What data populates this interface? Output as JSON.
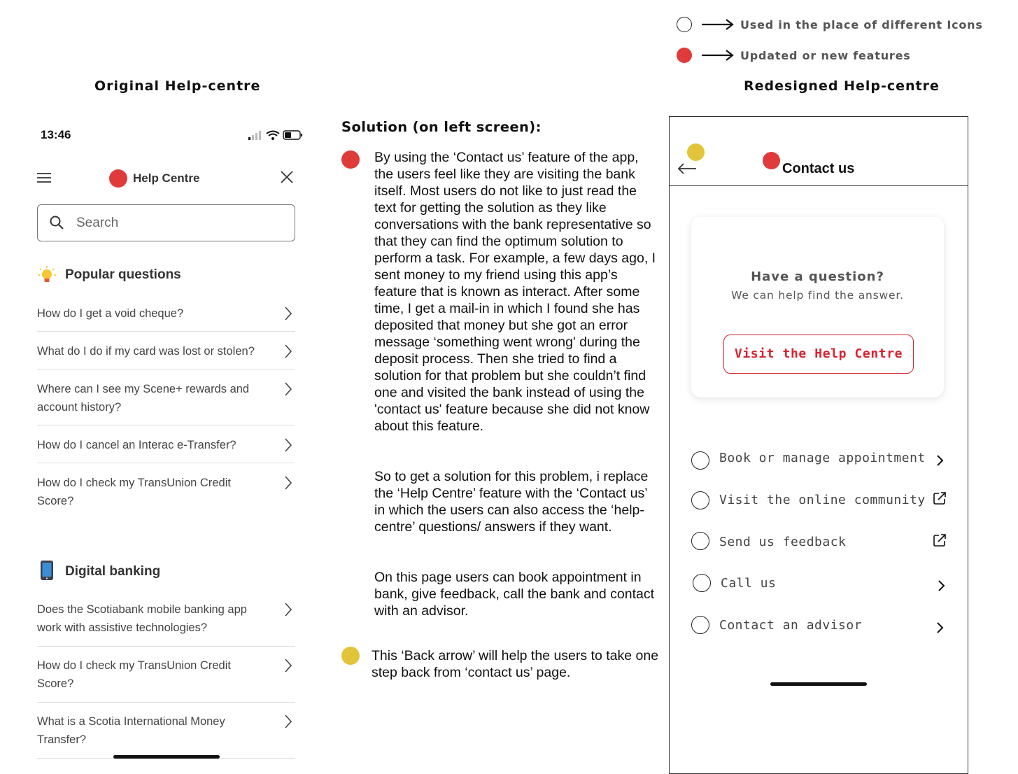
{
  "legend": {
    "outline_text": "Used in the place of different Icons",
    "red_text": "Updated or new features"
  },
  "headings": {
    "original": "Original Help-centre",
    "redesigned": "Redesigned Help-centre"
  },
  "original_app": {
    "status_time": "13:46",
    "title": "Help Centre",
    "search_placeholder": "Search",
    "sections": [
      {
        "title": "Popular questions",
        "icon": "lightbulb-icon",
        "questions": [
          "How do I get a void cheque?",
          "What do I do if my card was lost or stolen?",
          "Where can I see my Scene+ rewards and account history?",
          "How do I cancel an Interac e-Transfer?",
          "How do I check my TransUnion Credit Score?"
        ]
      },
      {
        "title": "Digital banking",
        "icon": "mobile-phone-icon",
        "questions": [
          "Does the Scotiabank mobile banking app work with assistive technologies?",
          "How do I check my TransUnion Credit Score?",
          "What is a Scotia International Money Transfer?"
        ]
      }
    ]
  },
  "solution": {
    "title": "Solution (on left screen):",
    "paragraph1": "By using the ‘Contact us’ feature of the app, the users feel like they are visiting the bank itself. Most users do not like to just read the text for getting the solution as they like conversations with the bank representative so that they can find the optimum solution to perform a task. For example, a few days ago, I sent money to my friend using this app’s feature that is known as interact. After some time, I get a mail-in in which I found she has deposited that money but she got an error message ‘something went wrong' during the deposit process. Then she tried to find a solution for that problem but she couldn’t find one and visited the bank instead of using the 'contact us' feature because she did not know about this feature.",
    "paragraph2": "So to get a solution for this problem, i replace the ‘Help Centre’ feature with the ‘Contact us’ in which the users can also access the ‘help-centre’ questions/ answers if they want.",
    "paragraph3": "On this page users can book appointment in bank, give feedback, call the bank and contact with an advisor.",
    "paragraph4": "This ‘Back arrow’ will help the users to take one step back from ‘contact us’ page."
  },
  "redesigned_app": {
    "title": "Contact us",
    "card_question": "Have a question?",
    "card_subtext": "We can help find the answer.",
    "visit_button": "Visit the Help Centre",
    "options": [
      {
        "label": "Book or manage appointment",
        "icon": "chevron-right-icon"
      },
      {
        "label": "Visit the online community",
        "icon": "external-link-icon"
      },
      {
        "label": "Send us feedback",
        "icon": "external-link-icon"
      },
      {
        "label": "Call us",
        "icon": "chevron-right-icon"
      },
      {
        "label": "Contact an advisor",
        "icon": "chevron-right-icon"
      }
    ]
  },
  "colors": {
    "accent_red": "#e03b3b",
    "accent_yellow": "#e2c43a",
    "button_red": "#d9232e"
  }
}
